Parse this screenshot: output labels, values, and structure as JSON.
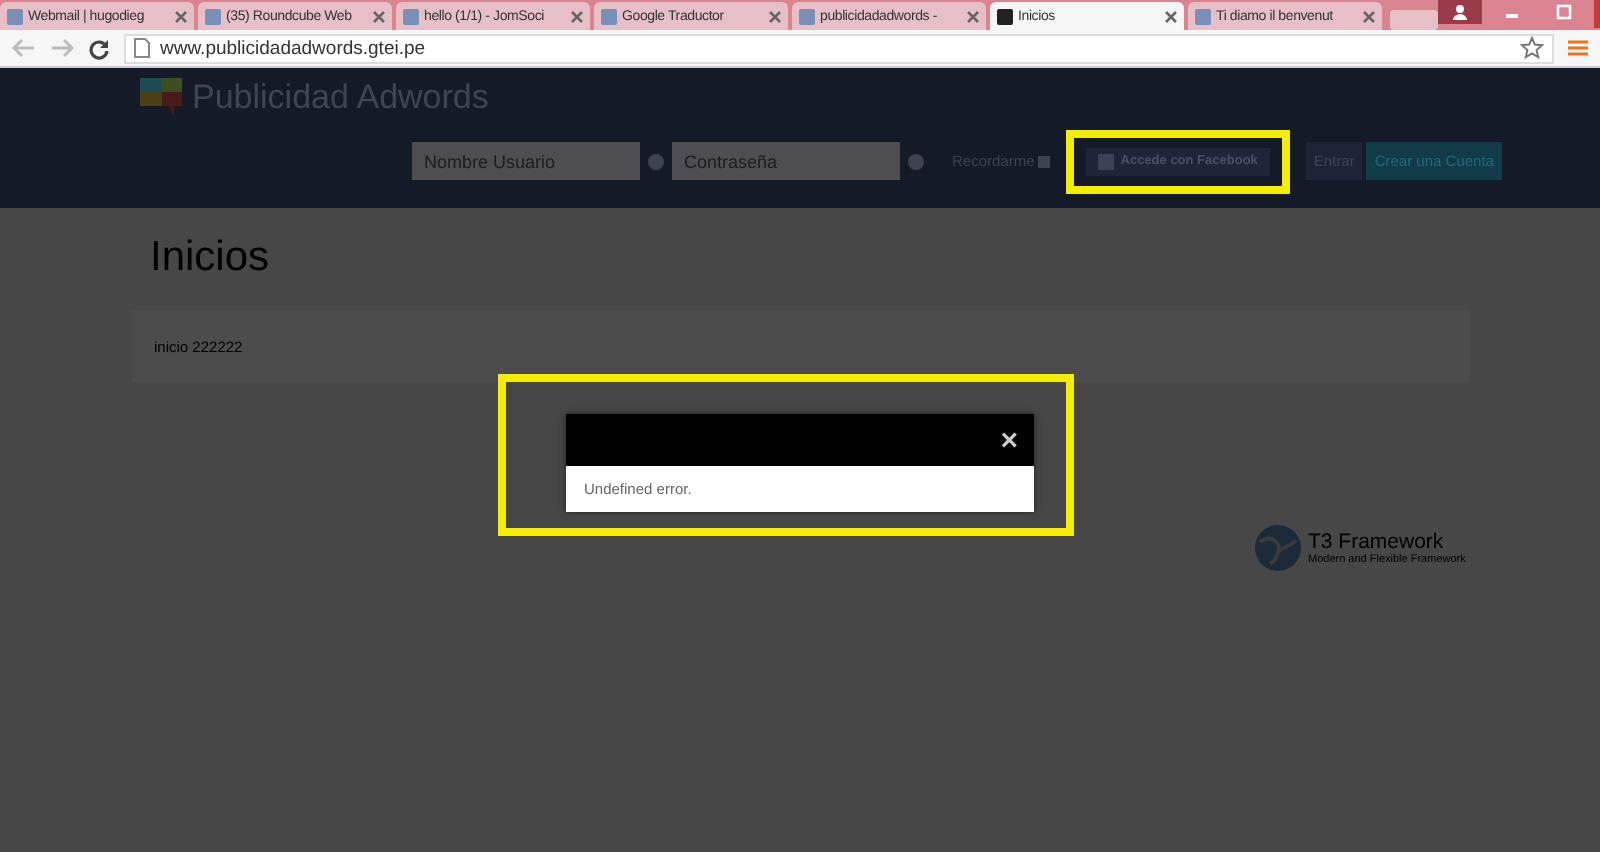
{
  "browser": {
    "tabs": [
      {
        "title": "Webmail | hugodieg",
        "selected": false
      },
      {
        "title": "(35) Roundcube Web",
        "selected": false
      },
      {
        "title": "hello (1/1) - JomSoci",
        "selected": false
      },
      {
        "title": "Google Traductor",
        "selected": false
      },
      {
        "title": "publicidadadwords -",
        "selected": false
      },
      {
        "title": "Inicios",
        "selected": true
      },
      {
        "title": "Ti diamo il benvenut",
        "selected": false
      }
    ],
    "url": "www.publicidadadwords.gtei.pe"
  },
  "site": {
    "title": "Publicidad Adwords",
    "login": {
      "username_placeholder": "Nombre Usuario",
      "password_placeholder": "Contraseña",
      "remember_label": "Recordarme",
      "remember_checked": false,
      "facebook_button": "Accede con Facebook",
      "login_button": "Entrar",
      "register_button": "Crear una Cuenta"
    },
    "page_title": "Inicios",
    "content": "inicio 222222",
    "footer_logo": {
      "name": "T3 Framework",
      "tagline": "Modern and Flexible Framework"
    }
  },
  "dialog": {
    "close": "×",
    "message": "Undefined error."
  }
}
